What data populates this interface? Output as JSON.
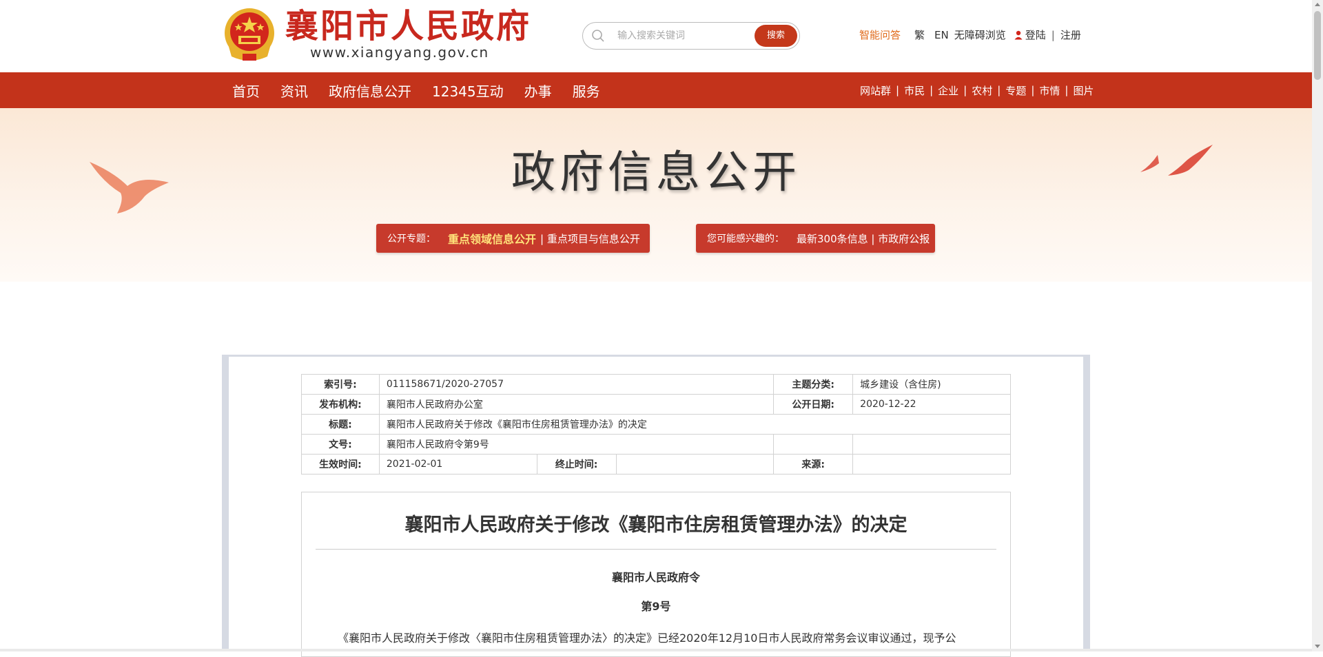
{
  "header": {
    "site_title": "襄阳市人民政府",
    "site_url": "www.xiangyang.gov.cn",
    "search_placeholder": "输入搜索关键词",
    "search_button": "搜索",
    "tools": {
      "ai_qa": "智能问答",
      "traditional": "繁",
      "english": "EN",
      "accessibility": "无障碍浏览",
      "login": "登陆",
      "separator": "|",
      "register": "注册"
    }
  },
  "nav": {
    "main": [
      "首页",
      "资讯",
      "政府信息公开",
      "12345互动",
      "办事",
      "服务"
    ],
    "side": [
      "网站群",
      "市民",
      "企业",
      "农村",
      "专题",
      "市情",
      "图片"
    ],
    "separator": "|"
  },
  "banner": {
    "title": "政府信息公开",
    "topic_label": "公开专题：",
    "topic_highlight": "重点领域信息公开",
    "topic_link": "| 重点项目与信息公开",
    "interest_label": "您可能感兴趣的：",
    "interest_links": "最新300条信息 | 市政府公报"
  },
  "meta": {
    "index_label": "索引号:",
    "index_value": "011158671/2020-27057",
    "topic_label": "主题分类:",
    "topic_value": "城乡建设（含住房)",
    "org_label": "发布机构:",
    "org_value": "襄阳市人民政府办公室",
    "date_label": "公开日期:",
    "date_value": "2020-12-22",
    "title_label": "标题:",
    "title_value": "襄阳市人民政府关于修改《襄阳市住房租赁管理办法》的决定",
    "docno_label": "文号:",
    "docno_value": "襄阳市人民政府令第9号",
    "effective_label": "生效时间:",
    "effective_value": "2021-02-01",
    "end_label": "终止时间:",
    "end_value": "",
    "source_label": "来源:",
    "source_value": ""
  },
  "article": {
    "title": "襄阳市人民政府关于修改《襄阳市住房租赁管理办法》的决定",
    "issuer": "襄阳市人民政府令",
    "number": "第9号",
    "paragraph": "《襄阳市人民政府关于修改〈襄阳市住房租赁管理办法〉的决定》已经2020年12月10日市人民政府常务会议审议通过，现予公"
  },
  "colors": {
    "brand_red": "#c3331b",
    "logo_red": "#c8281e",
    "ai_orange": "#e06a1a",
    "highlight_yellow": "#ffe27a"
  }
}
